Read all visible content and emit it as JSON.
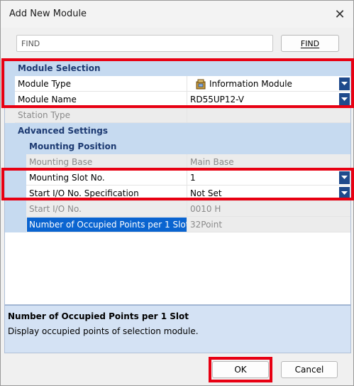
{
  "window": {
    "title": "Add New Module",
    "close_glyph": "✕"
  },
  "search": {
    "value": "FIND",
    "button_label": "FIND"
  },
  "properties": {
    "module_selection": {
      "header": "Module Selection",
      "module_type": {
        "label": "Module Type",
        "value": "Information Module",
        "icon": "module-icon"
      },
      "module_name": {
        "label": "Module Name",
        "value": "RD55UP12-V"
      },
      "station_type": {
        "label": "Station Type",
        "value": ""
      }
    },
    "advanced_settings": {
      "header": "Advanced Settings",
      "mounting_position": {
        "header": "Mounting Position",
        "mounting_base": {
          "label": "Mounting Base",
          "value": "Main Base"
        },
        "mounting_slot": {
          "label": "Mounting Slot No.",
          "value": "1"
        },
        "start_io_spec": {
          "label": "Start I/O No. Specification",
          "value": "Not Set"
        },
        "start_io": {
          "label": "Start I/O No.",
          "value": "0010 H"
        },
        "occupied_points": {
          "label": "Number of Occupied Points per 1 Slot",
          "value": "32Point"
        }
      }
    }
  },
  "description": {
    "title": "Number of Occupied Points per 1 Slot",
    "text": "Display occupied points of selection module."
  },
  "footer": {
    "ok_label": "OK",
    "cancel_label": "Cancel"
  },
  "colors": {
    "highlight": "#e80012",
    "category_bg": "#c6daf0",
    "selection": "#0a64d0",
    "dropdown": "#1f4a8c"
  }
}
